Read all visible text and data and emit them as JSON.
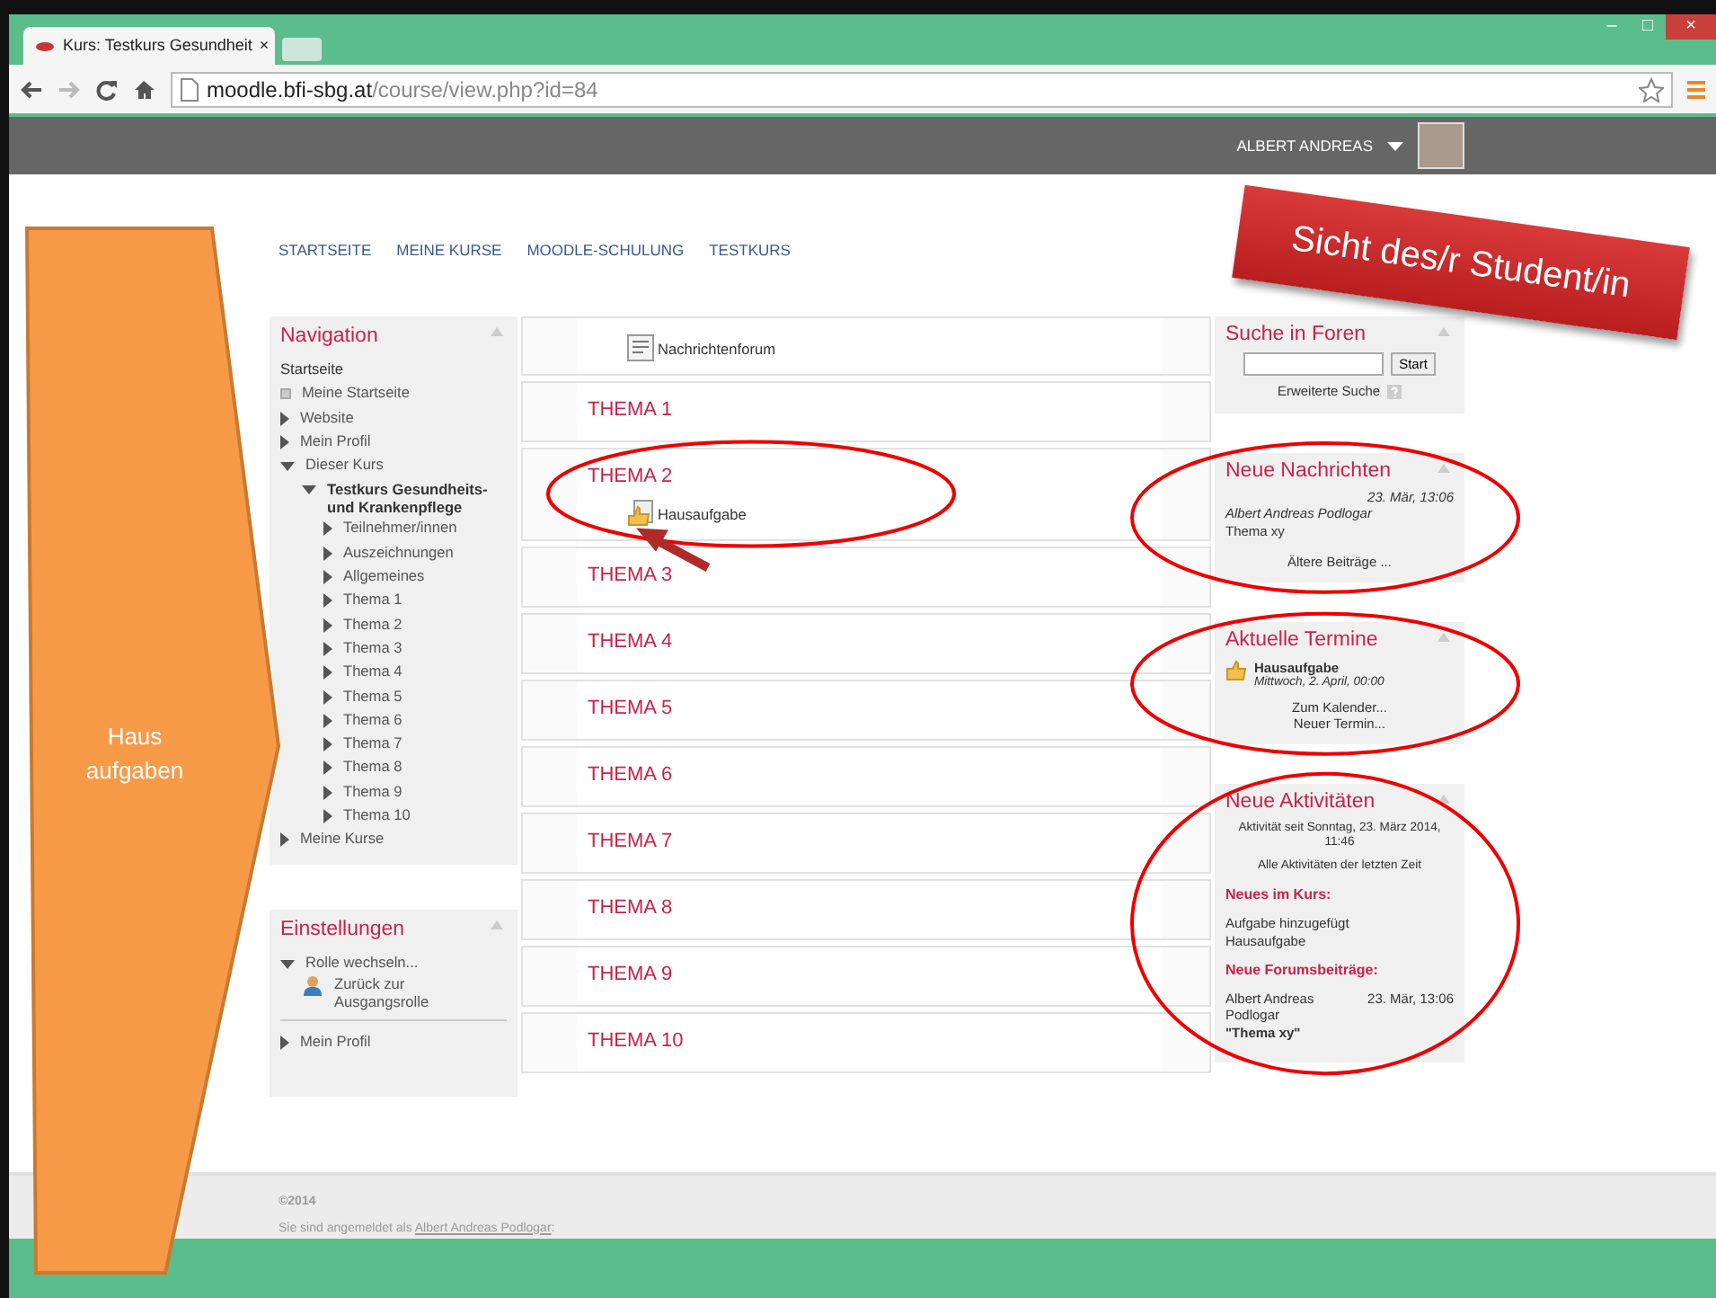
{
  "window_controls": [
    "–",
    "□",
    "×"
  ],
  "browser": {
    "tab_title": "Kurs: Testkurs Gesundheit",
    "tab_close": "×",
    "url_host": "moodle.bfi-sbg.at",
    "url_path": "/course/view.php?id=84"
  },
  "user_menu": {
    "name": "ALBERT ANDREAS"
  },
  "breadcrumb": [
    "STARTSEITE",
    "MEINE KURSE",
    "MOODLE-SCHULUNG",
    "TESTKURS"
  ],
  "navigation": {
    "title": "Navigation",
    "items": [
      {
        "label": "Startseite",
        "kind": "text"
      },
      {
        "label": "Meine Startseite",
        "kind": "page"
      },
      {
        "label": "Website",
        "kind": "branch",
        "expanded": false
      },
      {
        "label": "Mein Profil",
        "kind": "branch",
        "expanded": false
      },
      {
        "label": "Dieser Kurs",
        "kind": "branch",
        "expanded": true,
        "children": [
          {
            "label": "Testkurs Gesundheits- und Krankenpflege",
            "kind": "course",
            "expanded": true,
            "children": [
              {
                "label": "Teilnehmer/innen",
                "kind": "branch",
                "expanded": false
              },
              {
                "label": "Auszeichnungen",
                "kind": "branch",
                "expanded": false
              },
              {
                "label": "Allgemeines",
                "kind": "branch",
                "expanded": false
              },
              {
                "label": "Thema 1",
                "kind": "branch",
                "expanded": false
              },
              {
                "label": "Thema 2",
                "kind": "branch",
                "expanded": false
              },
              {
                "label": "Thema 3",
                "kind": "branch",
                "expanded": false
              },
              {
                "label": "Thema 4",
                "kind": "branch",
                "expanded": false
              },
              {
                "label": "Thema 5",
                "kind": "branch",
                "expanded": false
              },
              {
                "label": "Thema 6",
                "kind": "branch",
                "expanded": false
              },
              {
                "label": "Thema 7",
                "kind": "branch",
                "expanded": false
              },
              {
                "label": "Thema 8",
                "kind": "branch",
                "expanded": false
              },
              {
                "label": "Thema 9",
                "kind": "branch",
                "expanded": false
              },
              {
                "label": "Thema 10",
                "kind": "branch",
                "expanded": false
              }
            ]
          }
        ]
      },
      {
        "label": "Meine Kurse",
        "kind": "branch",
        "expanded": false
      }
    ]
  },
  "settings": {
    "title": "Einstellungen",
    "items": [
      {
        "label": "Rolle wechseln...",
        "kind": "branch",
        "expanded": true,
        "children": [
          {
            "label": "Zurück zur Ausgangsrolle",
            "kind": "role"
          }
        ]
      },
      {
        "label": "Mein Profil",
        "kind": "branch",
        "expanded": false,
        "divider": true
      }
    ]
  },
  "sections": [
    {
      "activities": [
        {
          "name": "Nachrichtenforum",
          "kind": "forum"
        }
      ]
    },
    {
      "title": "THEMA 1"
    },
    {
      "title": "THEMA 2",
      "activities": [
        {
          "name": "Hausaufgabe",
          "kind": "assignment"
        }
      ]
    },
    {
      "title": "THEMA 3"
    },
    {
      "title": "THEMA 4"
    },
    {
      "title": "THEMA 5"
    },
    {
      "title": "THEMA 6"
    },
    {
      "title": "THEMA 7"
    },
    {
      "title": "THEMA 8"
    },
    {
      "title": "THEMA 9"
    },
    {
      "title": "THEMA 10"
    }
  ],
  "search_forums": {
    "title": "Suche in Foren",
    "button": "Start",
    "link": "Erweiterte Suche"
  },
  "news": {
    "title": "Neue Nachrichten",
    "date": "23. Mär, 13:06",
    "author": "Albert Andreas Podlogar",
    "subject": "Thema xy",
    "more": "Ältere Beiträge ..."
  },
  "upcoming": {
    "title": "Aktuelle Termine",
    "events": [
      {
        "name": "Hausaufgabe",
        "date": "Mittwoch, 2. April, 00:00"
      }
    ],
    "links": [
      "Zum Kalender...",
      "Neuer Termin..."
    ]
  },
  "recent_activity": {
    "title": "Neue Aktivitäten",
    "since": "Aktivität seit Sonntag, 23. März 2014, 11:46",
    "all_link": "Alle Aktivitäten der letzten Zeit",
    "course_heading": "Neues im Kurs:",
    "course_items": [
      {
        "action": "Aufgabe hinzugefügt",
        "name": "Hausaufgabe"
      }
    ],
    "forum_heading": "Neue Forumsbeiträge:",
    "posts": [
      {
        "author": "Albert Andreas Podlogar",
        "date": "23. Mär, 13:06",
        "subject": "\"Thema xy\""
      }
    ]
  },
  "footer": {
    "copyright": "©2014",
    "login_prefix": "Sie sind angemeldet als",
    "login_name": "Albert Andreas Podlogar",
    "login_suffix": ":"
  },
  "annotations": {
    "banner": "Sicht des/r Student/in",
    "side_label": "Haus aufgaben"
  }
}
